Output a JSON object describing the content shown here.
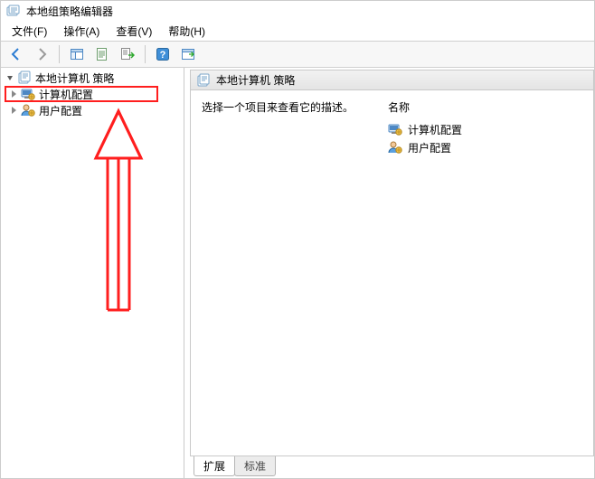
{
  "window": {
    "title": "本地组策略编辑器"
  },
  "menu": {
    "file": "文件(F)",
    "action": "操作(A)",
    "view": "查看(V)",
    "help": "帮助(H)"
  },
  "tree": {
    "root": {
      "label": "本地计算机 策略"
    },
    "items": [
      {
        "id": "computer",
        "label": "计算机配置"
      },
      {
        "id": "user",
        "label": "用户配置"
      }
    ]
  },
  "content": {
    "header": "本地计算机 策略",
    "description": "选择一个项目来查看它的描述。",
    "name_header": "名称",
    "items": [
      {
        "id": "computer",
        "label": "计算机配置"
      },
      {
        "id": "user",
        "label": "用户配置"
      }
    ]
  },
  "tabs": {
    "extended": "扩展",
    "standard": "标准"
  },
  "icons": {
    "back": "back-icon",
    "forward": "forward-icon",
    "up": "up-icon",
    "props": "properties-icon",
    "refresh": "refresh-icon",
    "export": "export-icon",
    "help": "help-icon",
    "show": "show-icon"
  }
}
